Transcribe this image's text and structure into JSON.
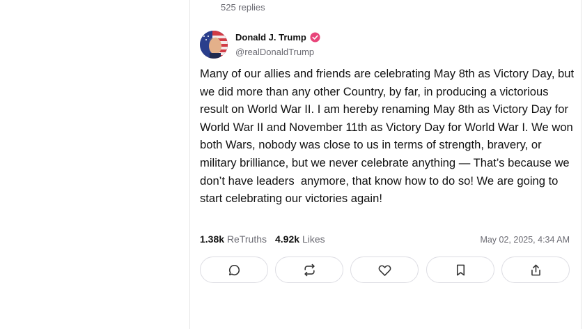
{
  "thread": {
    "replies_count": "525 replies"
  },
  "post": {
    "author": {
      "display_name": "Donald J. Trump",
      "handle": "@realDonaldTrump",
      "verified": true
    },
    "text": "Many of our allies and friends are celebrating May 8th as Victory Day, but we did more than any other Country, by far, in producing a victorious result on World War II. I am hereby renaming May 8th as Victory Day for World War II and November 11th as Victory Day for World War I. We won both Wars, nobody was close to us in terms of strength, bravery, or military brilliance, but we never celebrate anything — That’s because we don’t have leaders  anymore, that know how to do so! We are going to start celebrating our victories again!",
    "stats": {
      "retruths_count": "1.38k",
      "retruths_label": "ReTruths",
      "likes_count": "4.92k",
      "likes_label": "Likes"
    },
    "timestamp": "May 02, 2025, 4:34 AM"
  },
  "actions": [
    {
      "name": "reply",
      "icon": "comment-icon"
    },
    {
      "name": "retruth",
      "icon": "repost-icon"
    },
    {
      "name": "like",
      "icon": "heart-icon"
    },
    {
      "name": "bookmark",
      "icon": "bookmark-icon"
    },
    {
      "name": "share",
      "icon": "share-icon"
    }
  ],
  "colors": {
    "verified": "#e8457a",
    "muted_text": "#6b6b73",
    "border": "#dddde3"
  }
}
